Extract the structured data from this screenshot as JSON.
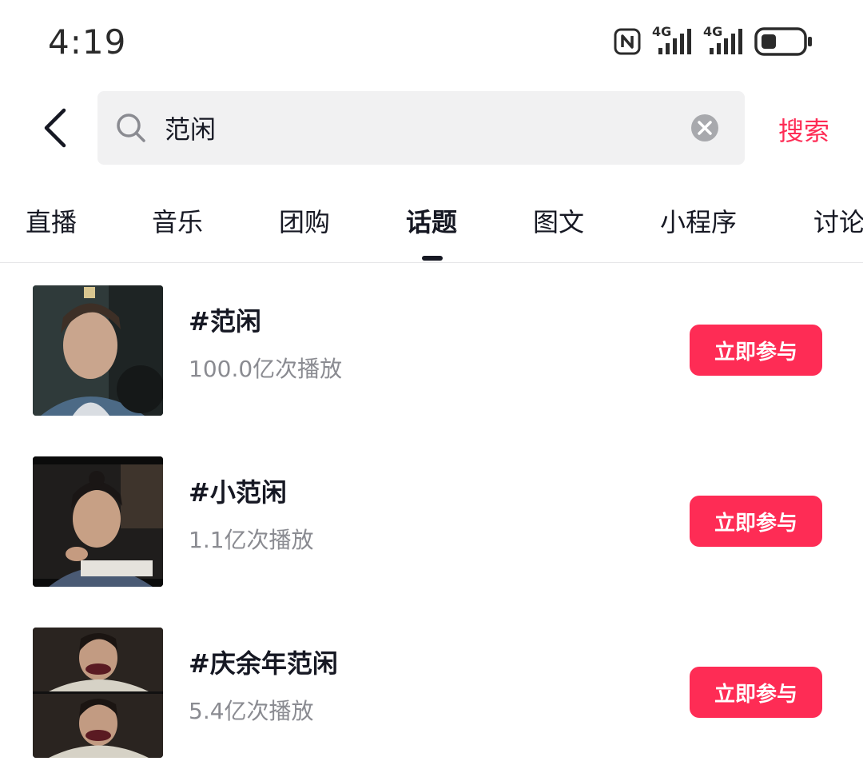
{
  "status_bar": {
    "time": "4:19",
    "network_1": "4G",
    "network_2": "4G",
    "icons": [
      "nfc-icon",
      "signal-4g-icon",
      "signal-4g-icon",
      "battery-icon"
    ]
  },
  "search": {
    "query": "范闲",
    "placeholder": "",
    "button_label": "搜索"
  },
  "tabs": [
    {
      "label": "直播",
      "active": false
    },
    {
      "label": "音乐",
      "active": false
    },
    {
      "label": "团购",
      "active": false
    },
    {
      "label": "话题",
      "active": true
    },
    {
      "label": "图文",
      "active": false
    },
    {
      "label": "小程序",
      "active": false
    },
    {
      "label": "讨论",
      "active": false
    }
  ],
  "topics": [
    {
      "title": "#范闲",
      "plays": "100.0亿次播放",
      "button": "立即参与"
    },
    {
      "title": "#小范闲",
      "plays": "1.1亿次播放",
      "button": "立即参与"
    },
    {
      "title": "#庆余年范闲",
      "plays": "5.4亿次播放",
      "button": "立即参与"
    }
  ],
  "colors": {
    "accent": "#fe2c55",
    "text_primary": "#161823",
    "text_secondary": "#8a8b91",
    "search_bg": "#f1f1f2"
  }
}
